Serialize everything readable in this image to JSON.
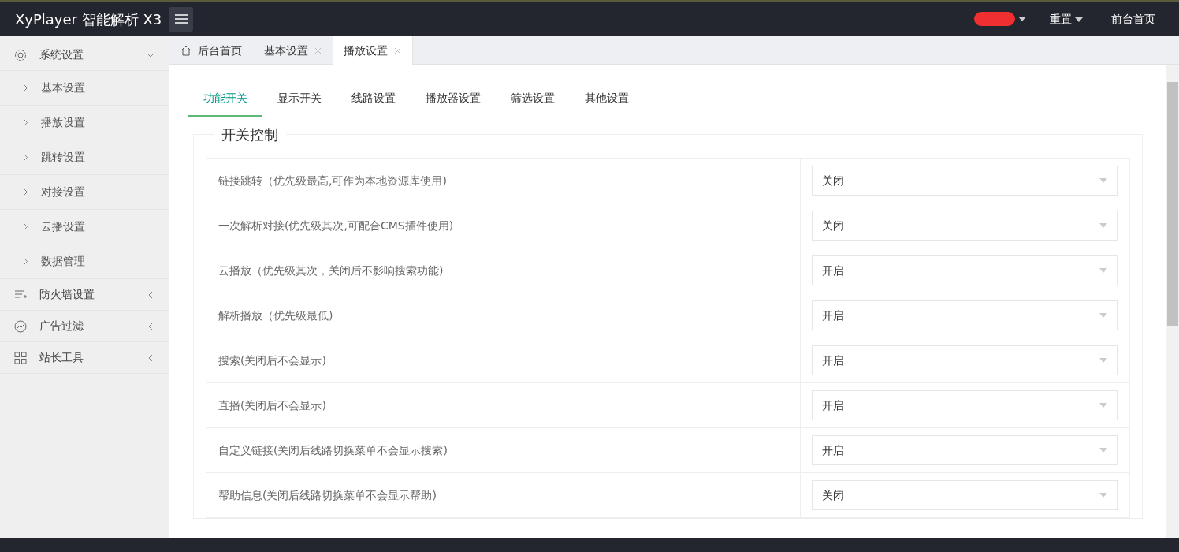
{
  "header": {
    "brand": "XyPlayer 智能解析 X3",
    "menu": [
      {
        "label": "重置",
        "dropdown": true
      },
      {
        "label": "前台首页",
        "dropdown": false
      }
    ]
  },
  "sidebar": {
    "items": [
      {
        "label": "系统设置",
        "expanded": true,
        "children": [
          {
            "label": "基本设置"
          },
          {
            "label": "播放设置"
          },
          {
            "label": "跳转设置"
          },
          {
            "label": "对接设置"
          },
          {
            "label": "云播设置"
          },
          {
            "label": "数据管理"
          }
        ]
      },
      {
        "label": "防火墙设置",
        "expanded": false
      },
      {
        "label": "广告过滤",
        "expanded": false
      },
      {
        "label": "站长工具",
        "expanded": false
      }
    ]
  },
  "page_tabs": [
    {
      "label": "后台首页",
      "closable": false,
      "selected": false
    },
    {
      "label": "基本设置",
      "closable": true,
      "selected": false
    },
    {
      "label": "播放设置",
      "closable": true,
      "selected": true
    }
  ],
  "sub_tabs": [
    {
      "label": "功能开关",
      "selected": true
    },
    {
      "label": "显示开关",
      "selected": false
    },
    {
      "label": "线路设置",
      "selected": false
    },
    {
      "label": "播放器设置",
      "selected": false
    },
    {
      "label": "筛选设置",
      "selected": false
    },
    {
      "label": "其他设置",
      "selected": false
    }
  ],
  "section_title": "开关控制",
  "settings": [
    {
      "label": "链接跳转（优先级最高,可作为本地资源库使用)",
      "value": "关闭"
    },
    {
      "label": "一次解析对接(优先级其次,可配合CMS插件使用)",
      "value": "关闭"
    },
    {
      "label": "云播放（优先级其次，关闭后不影响搜索功能)",
      "value": "开启"
    },
    {
      "label": "解析播放（优先级最低)",
      "value": "开启"
    },
    {
      "label": "搜索(关闭后不会显示)",
      "value": "开启"
    },
    {
      "label": "直播(关闭后不会显示)",
      "value": "开启"
    },
    {
      "label": "自定义链接(关闭后线路切换菜单不会显示搜索)",
      "value": "开启"
    },
    {
      "label": "帮助信息(关闭后线路切换菜单不会显示帮助)",
      "value": "关闭"
    }
  ]
}
